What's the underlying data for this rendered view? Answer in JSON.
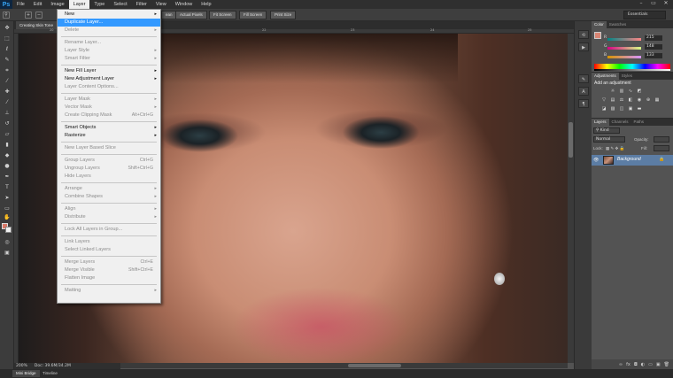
{
  "app": {
    "logo": "Ps"
  },
  "menubar": {
    "items": [
      "File",
      "Edit",
      "Image",
      "Layer",
      "Type",
      "Select",
      "Filter",
      "View",
      "Window",
      "Help"
    ],
    "active_index": 3,
    "window_controls": [
      "–",
      "▭",
      "✕"
    ]
  },
  "optionsbar": {
    "buttons": [
      "Actual Pixels",
      "Fit Screen",
      "Fill Screen",
      "Print Size"
    ],
    "partial_button": "ean",
    "workspace": "Essentials"
  },
  "document": {
    "tab_title": "Creating Skin Tone",
    "ruler_marks": [
      "20",
      "21",
      "22",
      "23",
      "24",
      "25"
    ]
  },
  "status": {
    "zoom": "200%",
    "doc_size": "Doc: 39.6M/34.2M"
  },
  "bottom_tabs": [
    "Mini Bridge",
    "Timeline"
  ],
  "color_panel": {
    "tabs": [
      "Color",
      "Swatches"
    ],
    "channels": [
      {
        "letter": "R",
        "value": "215"
      },
      {
        "letter": "G",
        "value": "148"
      },
      {
        "letter": "B",
        "value": "133"
      }
    ],
    "foreground": "#d88574",
    "background": "#f0f0f0"
  },
  "adjustments_panel": {
    "tabs": [
      "Adjustments",
      "Styles"
    ],
    "heading": "Add an adjustment"
  },
  "layers_panel": {
    "tabs": [
      "Layers",
      "Channels",
      "Paths"
    ],
    "filter": "Kind",
    "blend_mode": "Normal",
    "opacity_label": "Opacity:",
    "lock_label": "Lock:",
    "fill_label": "Fill:",
    "layer_name": "Background"
  },
  "layer_menu": {
    "items": [
      {
        "label": "New",
        "arrow": true
      },
      {
        "label": "Duplicate Layer...",
        "highlight": true
      },
      {
        "label": "Delete",
        "arrow": true,
        "disabled": true
      },
      {
        "sep": true
      },
      {
        "label": "Rename Layer...",
        "disabled": true
      },
      {
        "label": "Layer Style",
        "arrow": true,
        "disabled": true
      },
      {
        "label": "Smart Filter",
        "arrow": true,
        "disabled": true
      },
      {
        "sep": true
      },
      {
        "label": "New Fill Layer",
        "arrow": true
      },
      {
        "label": "New Adjustment Layer",
        "arrow": true
      },
      {
        "label": "Layer Content Options...",
        "disabled": true
      },
      {
        "sep": true
      },
      {
        "label": "Layer Mask",
        "arrow": true,
        "disabled": true
      },
      {
        "label": "Vector Mask",
        "arrow": true,
        "disabled": true
      },
      {
        "label": "Create Clipping Mask",
        "shortcut": "Alt+Ctrl+G",
        "disabled": true
      },
      {
        "sep": true
      },
      {
        "label": "Smart Objects",
        "arrow": true
      },
      {
        "label": "Rasterize",
        "arrow": true
      },
      {
        "sep": true
      },
      {
        "label": "New Layer Based Slice",
        "disabled": true
      },
      {
        "sep": true
      },
      {
        "label": "Group Layers",
        "shortcut": "Ctrl+G",
        "disabled": true
      },
      {
        "label": "Ungroup Layers",
        "shortcut": "Shift+Ctrl+G",
        "disabled": true
      },
      {
        "label": "Hide Layers",
        "disabled": true
      },
      {
        "sep": true
      },
      {
        "label": "Arrange",
        "arrow": true,
        "disabled": true
      },
      {
        "label": "Combine Shapes",
        "arrow": true,
        "disabled": true
      },
      {
        "sep": true
      },
      {
        "label": "Align",
        "arrow": true,
        "disabled": true
      },
      {
        "label": "Distribute",
        "arrow": true,
        "disabled": true
      },
      {
        "sep": true
      },
      {
        "label": "Lock All Layers in Group...",
        "disabled": true
      },
      {
        "sep": true
      },
      {
        "label": "Link Layers",
        "disabled": true
      },
      {
        "label": "Select Linked Layers",
        "disabled": true
      },
      {
        "sep": true
      },
      {
        "label": "Merge Layers",
        "shortcut": "Ctrl+E",
        "disabled": true
      },
      {
        "label": "Merge Visible",
        "shortcut": "Shift+Ctrl+E",
        "disabled": true
      },
      {
        "label": "Flatten Image",
        "disabled": true
      },
      {
        "sep": true
      },
      {
        "label": "Matting",
        "arrow": true,
        "disabled": true
      }
    ]
  }
}
